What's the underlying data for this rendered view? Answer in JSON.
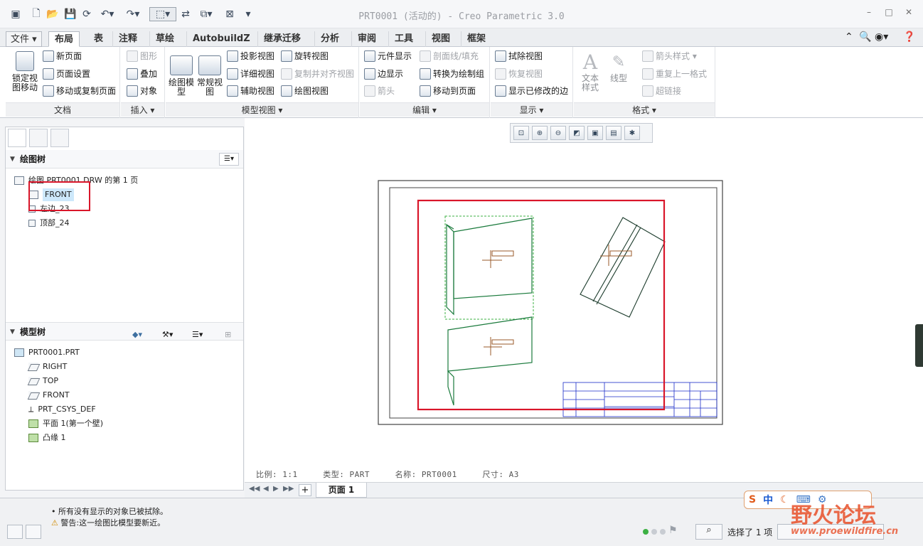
{
  "window": {
    "title": "PRT0001 (活动的) - Creo Parametric 3.0",
    "controls": [
      "–",
      "□",
      "✕"
    ]
  },
  "ribbon": {
    "tabs": [
      "文件",
      "布局",
      "表",
      "注释",
      "草绘",
      "AutobuildZ",
      "继承迁移",
      "分析",
      "审阅",
      "工具",
      "视图",
      "框架"
    ],
    "groups": {
      "document": {
        "label": "文档",
        "lock": "锁定视图移动",
        "items": [
          "新页面",
          "页面设置",
          "移动或复制页面"
        ]
      },
      "insert": {
        "label": "插入",
        "items": [
          "图形",
          "叠加",
          "对象"
        ]
      },
      "model_views": {
        "label": "模型视图",
        "big": [
          "绘图模型",
          "常规视图"
        ],
        "col1": [
          "投影视图",
          "详细视图",
          "辅助视图"
        ],
        "col2": [
          "旋转视图",
          "复制并对齐视图",
          "绘图视图"
        ]
      },
      "edit": {
        "label": "编辑",
        "col1": [
          "元件显示",
          "边显示",
          "箭头"
        ],
        "col2": [
          "剖面线/填充",
          "转换为绘制组",
          "移动到页面"
        ]
      },
      "display": {
        "label": "显示",
        "items": [
          "拭除视图",
          "恢复视图",
          "显示已修改的边"
        ]
      },
      "format": {
        "label": "格式",
        "big": [
          "文本样式",
          "线型"
        ],
        "items": [
          "箭头样式",
          "重复上一格式",
          "超链接"
        ]
      }
    }
  },
  "drawing_tree": {
    "header": "绘图树",
    "root": "绘图 PRT0001.DRW 的第 1 页",
    "items": [
      "FRONT",
      "左边_23",
      "顶部_24"
    ]
  },
  "model_tree": {
    "header": "模型树",
    "items": [
      "PRT0001.PRT",
      "RIGHT",
      "TOP",
      "FRONT",
      "PRT_CSYS_DEF",
      "平面 1(第一个壁)",
      "凸缘 1"
    ]
  },
  "sheet_info": {
    "scale_label": "比例",
    "scale": "1:1",
    "type_label": "类型",
    "type": "PART",
    "name_label": "名称",
    "name": "PRT0001",
    "size_label": "尺寸",
    "size": "A3"
  },
  "page": {
    "label": "页面 1"
  },
  "messages": [
    {
      "icon": "•",
      "text": "所有没有显示的对象已被拭除。"
    },
    {
      "icon": "⚠",
      "text": "警告:这一绘图比模型要新近。"
    }
  ],
  "status": {
    "selection": "选择了 1 项"
  },
  "watermark": {
    "main": "野火论坛",
    "url": "www.proewildfire.cn",
    "ime": "中"
  },
  "colors": {
    "highlight_red": "#d9162a",
    "sheet_green": "#1a7a3c",
    "title_block_blue": "#1a2cc8"
  }
}
